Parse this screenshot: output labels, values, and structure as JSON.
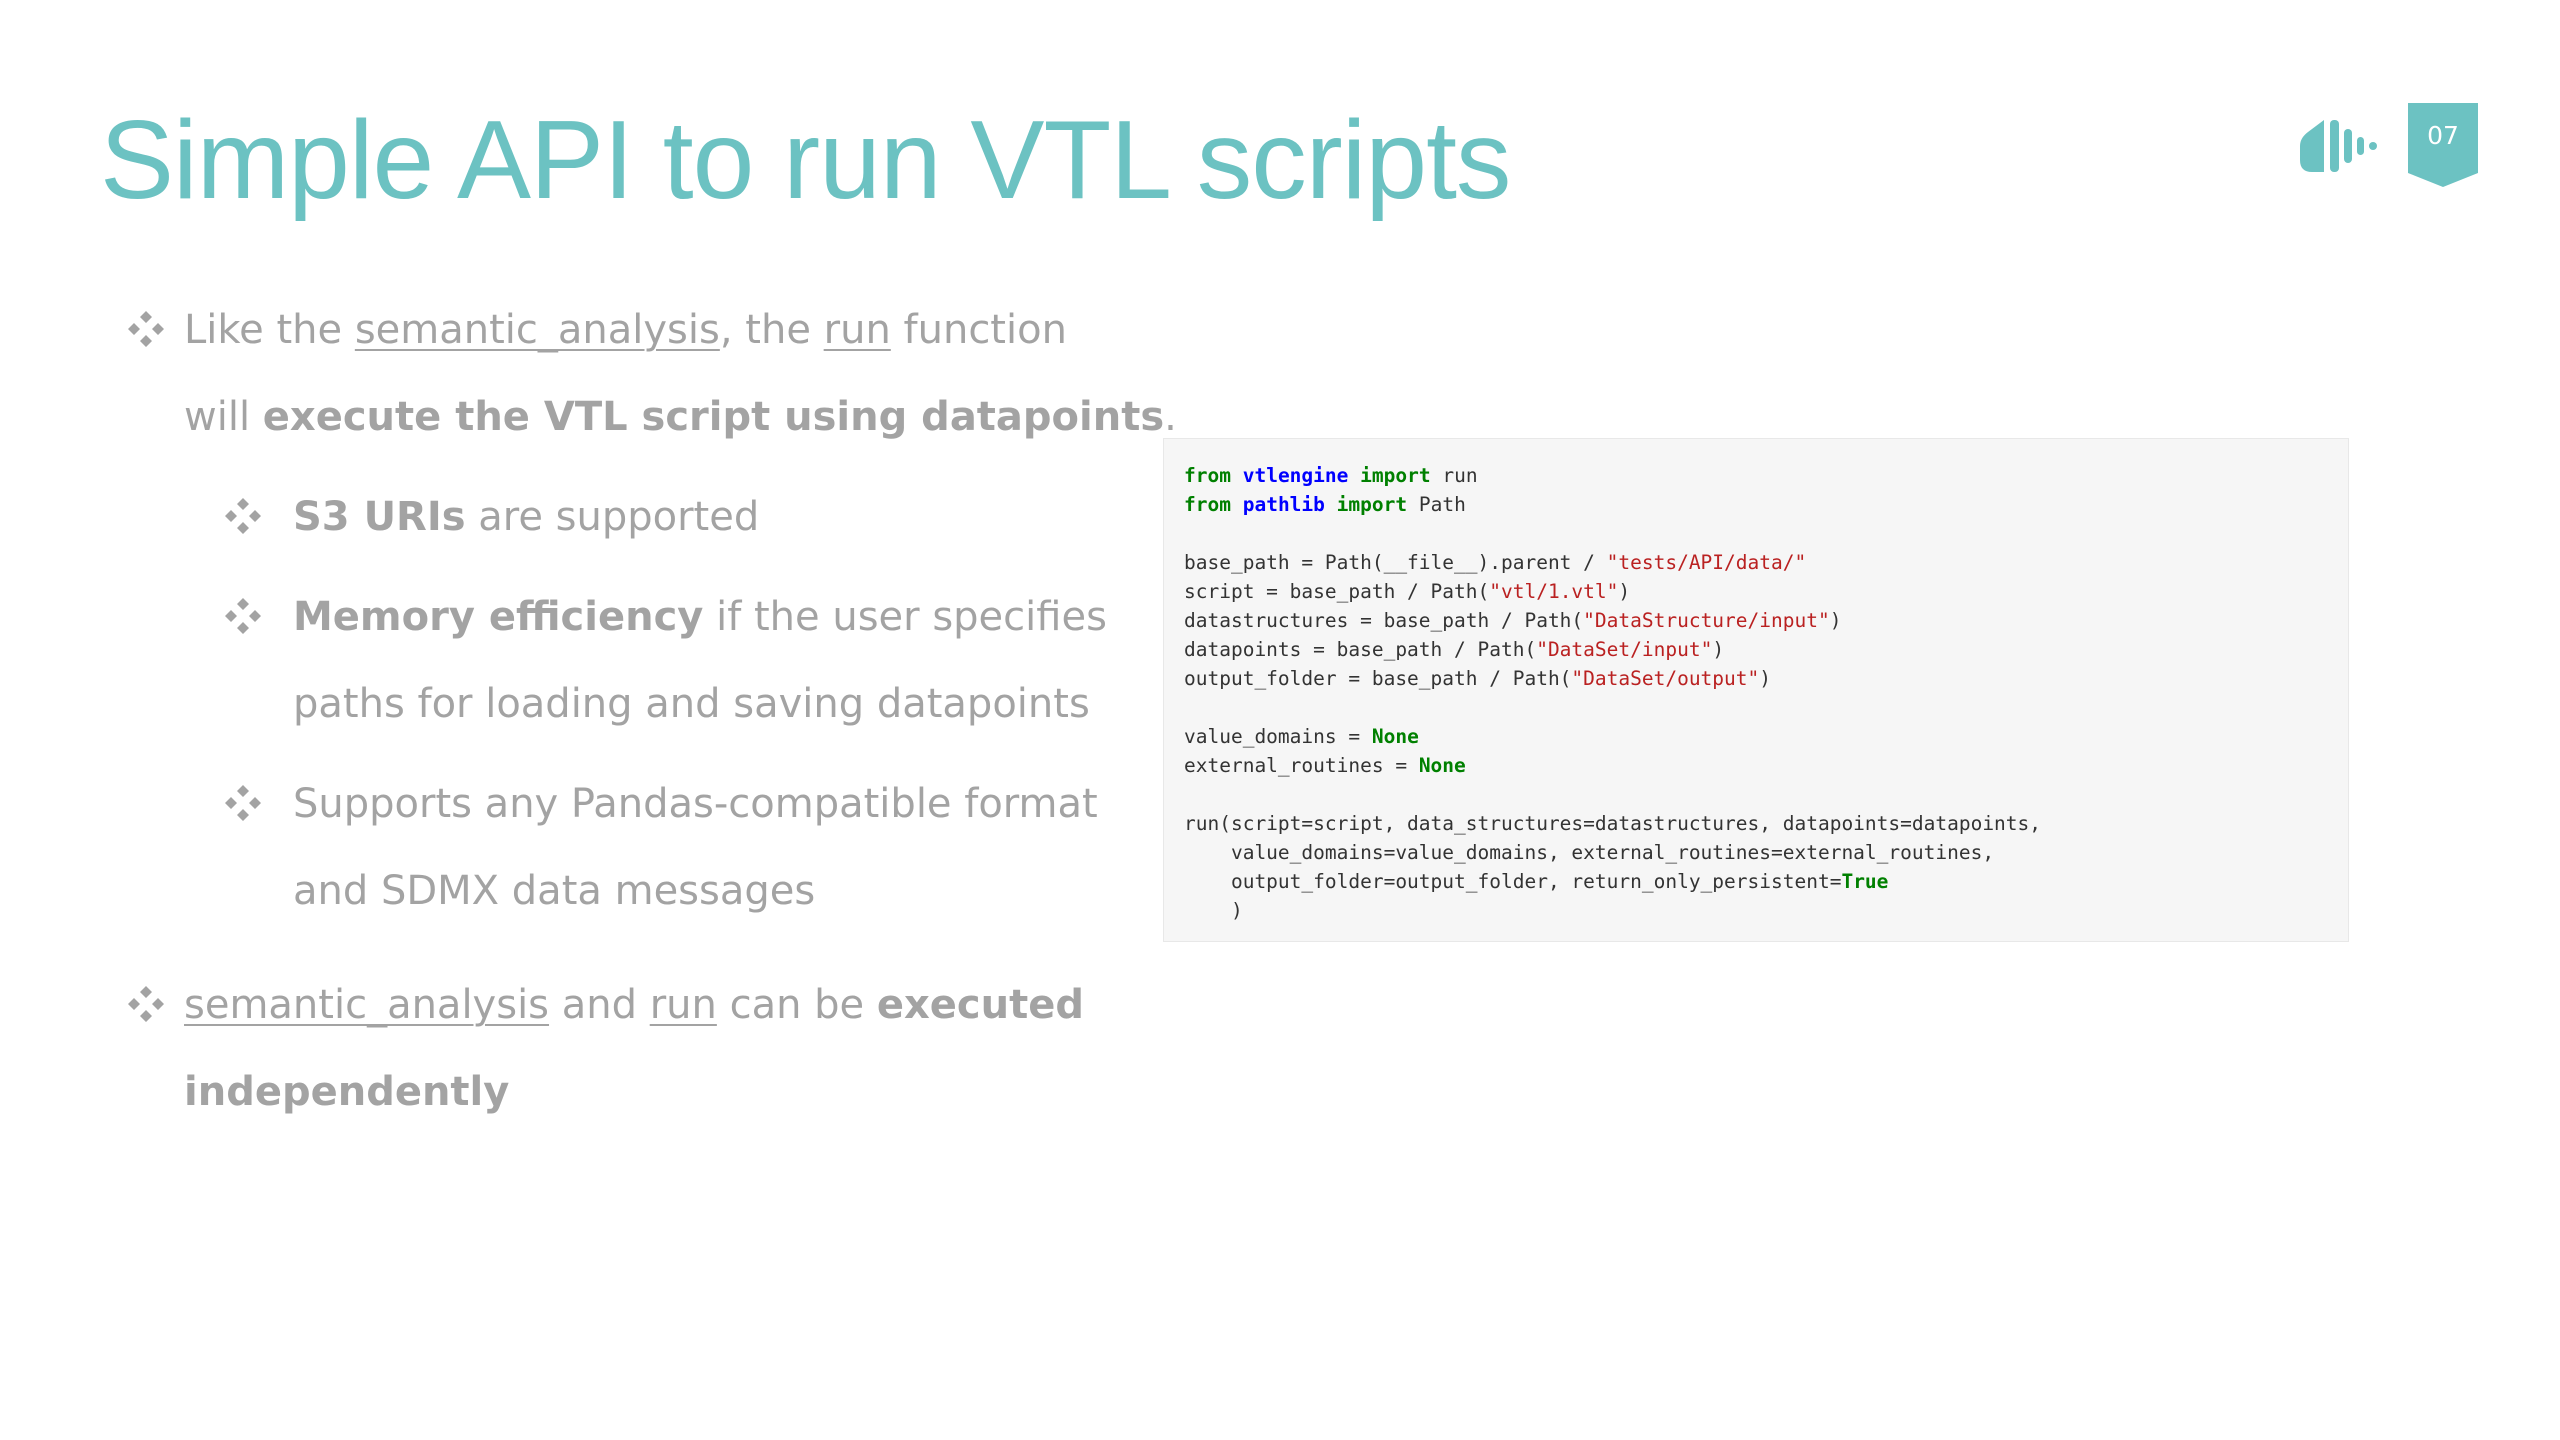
{
  "slide": {
    "title": "Simple API to run VTL scripts",
    "page_number": "07",
    "accent_color": "#6cc2c2",
    "logo_icon": "sound-wave-logo-icon",
    "bullet_icon": "four-diamond-bullet-icon"
  },
  "bullets": {
    "b1": {
      "p1": "Like the ",
      "p2": "semantic_analysis",
      "p3": ", the ",
      "p4": "run",
      "p5": " function",
      "p6": "will ",
      "p7": "execute the VTL script using datapoints",
      "p8": "."
    },
    "b1a": {
      "p1": "S3 URIs",
      "p2": " are supported"
    },
    "b1b": {
      "p1": "Memory efficiency",
      "p2": " if the user specifies",
      "p3": "paths for loading and saving datapoints"
    },
    "b1c": {
      "p1": "Supports any Pandas-compatible format",
      "p2": "and SDMX data messages"
    },
    "b2": {
      "p1": "semantic_analysis",
      "p2": " and ",
      "p3": "run",
      "p4": " can be ",
      "p5": "executed",
      "p6": "independently"
    }
  },
  "code": {
    "l1": {
      "kw1": "from",
      "mod": "vtlengine",
      "kw2": "import",
      "rest": "run"
    },
    "l2": {
      "kw1": "from",
      "mod": "pathlib",
      "kw2": "import",
      "rest": "Path"
    },
    "l4": {
      "a": "base_path = Path(__file__).parent / ",
      "s": "\"tests/API/data/\""
    },
    "l5": {
      "a": "script = base_path / Path(",
      "s": "\"vtl/1.vtl\"",
      "b": ")"
    },
    "l6": {
      "a": "datastructures = base_path / Path(",
      "s": "\"DataStructure/input\"",
      "b": ")"
    },
    "l7": {
      "a": "datapoints = base_path / Path(",
      "s": "\"DataSet/input\"",
      "b": ")"
    },
    "l8": {
      "a": "output_folder = base_path / Path(",
      "s": "\"DataSet/output\"",
      "b": ")"
    },
    "l10": {
      "a": "value_domains = ",
      "c": "None"
    },
    "l11": {
      "a": "external_routines = ",
      "c": "None"
    },
    "l13": {
      "a": "run(script=script, data_structures=datastructures, datapoints=datapoints,"
    },
    "l14": {
      "a": "    value_domains=value_domains, external_routines=external_routines,"
    },
    "l15": {
      "a": "    output_folder=output_folder, return_only_persistent=",
      "c": "True"
    },
    "l16": {
      "a": "    )"
    }
  }
}
